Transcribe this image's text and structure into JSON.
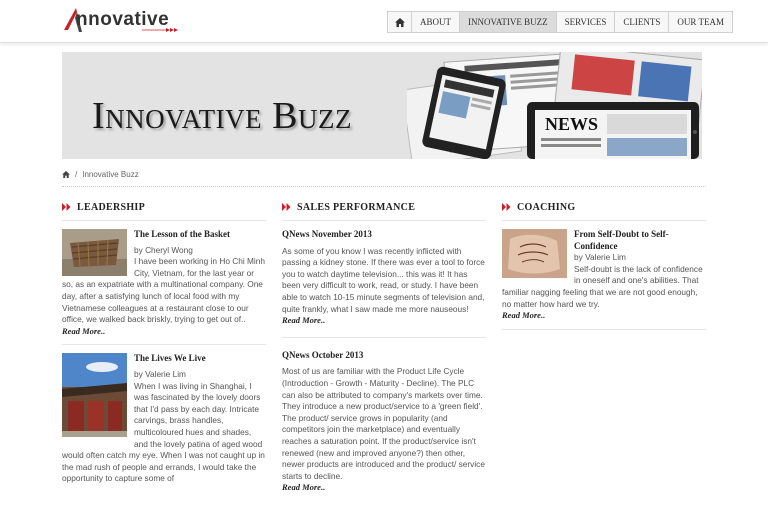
{
  "header": {
    "logo_text": "nnovative",
    "nav": [
      {
        "label": "",
        "icon": "home-icon"
      },
      {
        "label": "ABOUT"
      },
      {
        "label": "INNOVATIVE BUZZ",
        "active": true
      },
      {
        "label": "SERVICES"
      },
      {
        "label": "CLIENTS"
      },
      {
        "label": "OUR TEAM"
      }
    ]
  },
  "banner": {
    "title": "Innovative Buzz"
  },
  "breadcrumb": {
    "separator": "/",
    "current": "Innovative Buzz"
  },
  "columns": [
    {
      "title": "LEADERSHIP",
      "posts": [
        {
          "title": "The Lesson of the Basket",
          "author": "by Cheryl Wong",
          "body": "I have been working in Ho Chi Minh City, Vietnam, for the last year or so, as an expatriate with a multinational company. One day, after a satisfying lunch of local food with my Vietnamese colleagues at a restaurant close to our office, we walked back briskly, trying to get out of..",
          "read_more": "Read More.."
        },
        {
          "title": "The Lives We Live",
          "author": "by Valerie Lim",
          "body": "When I was living in Shanghai, I was fascinated by the lovely doors that I'd pass by each day. Intricate carvings, brass handles, multicoloured hues and shades, and the lovely patina of aged wood would often catch my eye. When I was not caught up in the mad rush of people and errands, I would take the opportunity to capture some of"
        }
      ]
    },
    {
      "title": "SALES PERFORMANCE",
      "posts": [
        {
          "title": "QNews November 2013",
          "body": "As some of you know I was recently inflicted with passing a kidney stone. If there was ever a tool to force you to watch daytime television... this was it! It has been very difficult to work, read, or study. I have been able to watch 10-15 minute segments of television and, quite frankly, what I saw made me more nauseous!",
          "read_more": "Read More.."
        },
        {
          "title": "QNews October 2013",
          "body": "Most of us are familiar with the Product Life Cycle (Introduction - Growth - Maturity - Decline). The PLC can also be attributed to company's markets over time. They introduce a new product/service to a 'green field'. The product/ service grows in popularity (and competitors join the marketplace) and eventually reaches a saturation point. If the product/service isn't renewed (new and improved anyone?) then other, newer products are introduced and the product/ service starts to decline.",
          "read_more": "Read More.."
        }
      ]
    },
    {
      "title": "COACHING",
      "posts": [
        {
          "title": "From Self-Doubt to Self-Confidence",
          "author": "by Valerie Lim",
          "body": "Self-doubt is the lack of confidence in oneself and one's abilities. That familiar nagging feeling that we are not good enough, no matter how hard we try.",
          "read_more": "Read More.."
        }
      ]
    }
  ],
  "colors": {
    "accent_red": "#c8202a",
    "header_border": "#e2e2e2",
    "nav_active": "#dcdcdc"
  }
}
